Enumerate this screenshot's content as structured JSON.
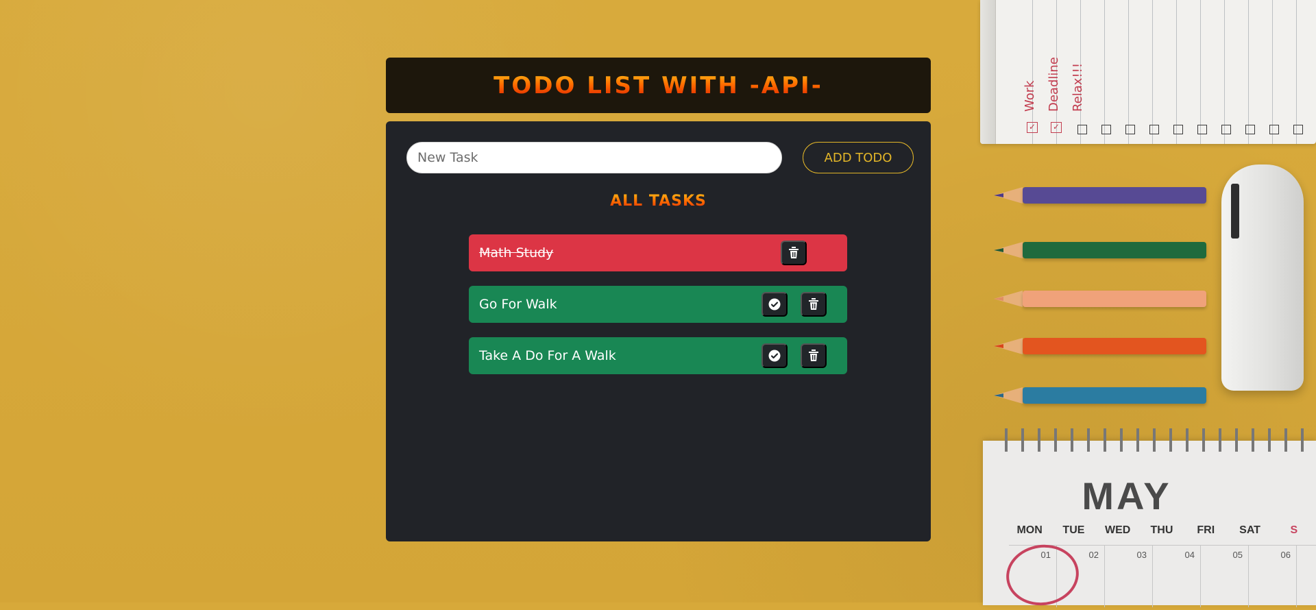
{
  "header": {
    "title": "TODO LIST WITH -API-"
  },
  "input": {
    "placeholder": "New Task",
    "value": ""
  },
  "actions": {
    "add_label": "ADD TODO"
  },
  "section": {
    "title": "ALL TASKS"
  },
  "tasks": [
    {
      "text": "Math Study",
      "done": true,
      "color": "#dc3545",
      "buttons": [
        "trash-icon"
      ]
    },
    {
      "text": "Go For Walk",
      "done": false,
      "color": "#198754",
      "buttons": [
        "check-circle-icon",
        "trash-icon"
      ]
    },
    {
      "text": "Take A Do For A Walk",
      "done": false,
      "color": "#198754",
      "buttons": [
        "check-circle-icon",
        "trash-icon"
      ]
    }
  ],
  "background": {
    "notebook_labels": [
      "Work",
      "Deadline",
      "Relax!!!"
    ],
    "calendar": {
      "month": "MAY",
      "days": [
        "MON",
        "TUE",
        "WED",
        "THU",
        "FRI",
        "SAT",
        "S"
      ],
      "dates": [
        "01",
        "02",
        "03",
        "04",
        "05",
        "06"
      ]
    }
  }
}
